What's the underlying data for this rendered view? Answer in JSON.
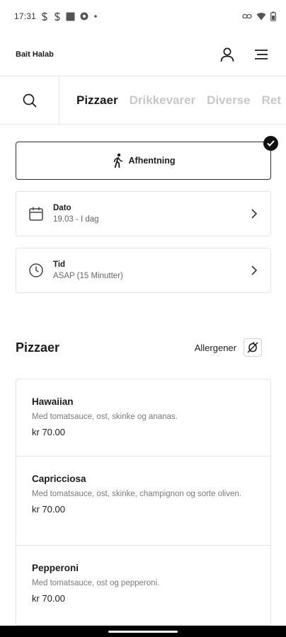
{
  "status_bar": {
    "time": "17:31",
    "icons": [
      "s-notification-icon",
      "s-notification-icon",
      "square-notification-icon",
      "settings-notification-icon",
      "dot-icon",
      "link-icon",
      "wifi-icon",
      "battery-icon"
    ]
  },
  "header": {
    "brand": "Bait Halab",
    "icons": [
      "user-icon",
      "menu-icon"
    ]
  },
  "categories": {
    "search_icon": "search-icon",
    "tabs": [
      {
        "label": "Pizzaer",
        "active": true
      },
      {
        "label": "Drikkevarer",
        "active": false
      },
      {
        "label": "Diverse",
        "active": false
      },
      {
        "label": "Ret",
        "active": false
      }
    ]
  },
  "delivery": {
    "label": "Afhentning",
    "icon": "walking-person-icon",
    "selected": true
  },
  "date": {
    "title": "Dato",
    "value": "19.03 - I dag"
  },
  "time": {
    "title": "Tid",
    "value": "ASAP (15 Minutter)"
  },
  "section": {
    "title": "Pizzaer",
    "allergen_label": "Allergener"
  },
  "products": [
    {
      "name": "Hawaiian",
      "description": "Med tomatsauce, ost, skinke og ananas.",
      "price": "kr 70.00"
    },
    {
      "name": "Capricciosa",
      "description": "Med tomatsauce, ost, skinke, champignon og sorte oliven.",
      "price": "kr 70.00"
    },
    {
      "name": "Pepperoni",
      "description": "Med tomatsauce, ost og pepperoni.",
      "price": "kr 70.00"
    }
  ],
  "colors": {
    "text": "#1b1b1b",
    "muted": "#7a7a7a",
    "inactive_tab": "#c8c8c8",
    "border": "#e4e4e4",
    "accent": "#111111"
  }
}
